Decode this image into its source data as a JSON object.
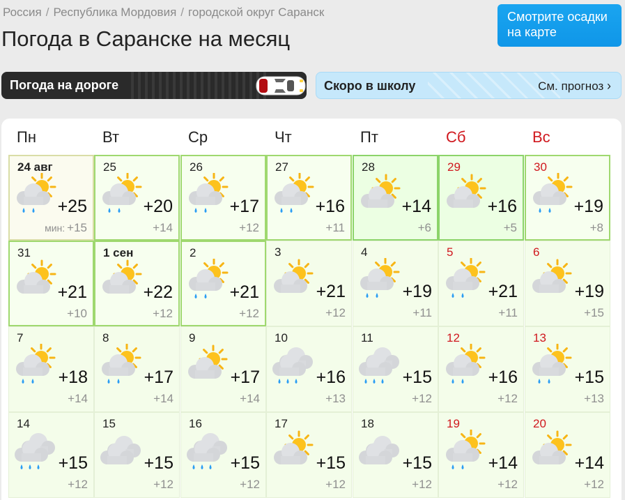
{
  "breadcrumbs": [
    "Россия",
    "Республика Мордовия",
    "городской округ Саранск"
  ],
  "breadcrumb_sep": "/",
  "title": "Погода в Саранске на месяц",
  "map_button": "Смотрите осадки на карте",
  "road_banner": "Погода на дороге",
  "school_banner": {
    "label": "Скоро в школу",
    "link": "См. прогноз"
  },
  "colors": {
    "weekend": "#d0181e",
    "accent": "#1aa5f0",
    "highlight_border": "#9fd86f"
  },
  "weekdays": [
    {
      "label": "Пн",
      "weekend": false
    },
    {
      "label": "Вт",
      "weekend": false
    },
    {
      "label": "Ср",
      "weekend": false
    },
    {
      "label": "Чт",
      "weekend": false
    },
    {
      "label": "Пт",
      "weekend": false
    },
    {
      "label": "Сб",
      "weekend": true
    },
    {
      "label": "Вс",
      "weekend": true
    }
  ],
  "min_label": "мин:",
  "days": [
    {
      "day": "24 авг",
      "bold": true,
      "weekend": false,
      "max": "+25",
      "min": "+15",
      "icon": "sun-cloud-rain-icon",
      "state": "past",
      "show_min_label": true
    },
    {
      "day": "25",
      "bold": false,
      "weekend": false,
      "max": "+20",
      "min": "+14",
      "icon": "sun-cloud-rain-icon",
      "state": "hl"
    },
    {
      "day": "26",
      "bold": false,
      "weekend": false,
      "max": "+17",
      "min": "+12",
      "icon": "sun-cloud-rain-icon",
      "state": "hl"
    },
    {
      "day": "27",
      "bold": false,
      "weekend": false,
      "max": "+16",
      "min": "+11",
      "icon": "sun-cloud-rain-icon",
      "state": "hl"
    },
    {
      "day": "28",
      "bold": false,
      "weekend": false,
      "max": "+14",
      "min": "+6",
      "icon": "sun-cloud-icon",
      "state": "hlg"
    },
    {
      "day": "29",
      "bold": false,
      "weekend": true,
      "max": "+16",
      "min": "+5",
      "icon": "sun-cloud-icon",
      "state": "hlg"
    },
    {
      "day": "30",
      "bold": false,
      "weekend": true,
      "max": "+19",
      "min": "+8",
      "icon": "sun-cloud-rain-icon",
      "state": "hl"
    },
    {
      "day": "31",
      "bold": false,
      "weekend": false,
      "max": "+21",
      "min": "+10",
      "icon": "sun-cloud-icon",
      "state": "hl"
    },
    {
      "day": "1 сен",
      "bold": true,
      "weekend": false,
      "max": "+22",
      "min": "+12",
      "icon": "sun-cloud-icon",
      "state": "hl"
    },
    {
      "day": "2",
      "bold": false,
      "weekend": false,
      "max": "+21",
      "min": "+12",
      "icon": "sun-cloud-rain-icon",
      "state": "hl"
    },
    {
      "day": "3",
      "bold": false,
      "weekend": false,
      "max": "+21",
      "min": "+12",
      "icon": "sun-cloud-icon",
      "state": "lt"
    },
    {
      "day": "4",
      "bold": false,
      "weekend": false,
      "max": "+19",
      "min": "+11",
      "icon": "sun-cloud-rain-icon",
      "state": "lt"
    },
    {
      "day": "5",
      "bold": false,
      "weekend": true,
      "max": "+21",
      "min": "+11",
      "icon": "sun-cloud-rain-icon",
      "state": "lt"
    },
    {
      "day": "6",
      "bold": false,
      "weekend": true,
      "max": "+19",
      "min": "+15",
      "icon": "sun-cloud-icon",
      "state": "lt"
    },
    {
      "day": "7",
      "bold": false,
      "weekend": false,
      "max": "+18",
      "min": "+14",
      "icon": "sun-cloud-rain-icon",
      "state": "lt"
    },
    {
      "day": "8",
      "bold": false,
      "weekend": false,
      "max": "+17",
      "min": "+14",
      "icon": "sun-cloud-rain-icon",
      "state": "lt"
    },
    {
      "day": "9",
      "bold": false,
      "weekend": false,
      "max": "+17",
      "min": "+14",
      "icon": "sun-cloud-icon",
      "state": "lt"
    },
    {
      "day": "10",
      "bold": false,
      "weekend": false,
      "max": "+16",
      "min": "+13",
      "icon": "cloud-rain-icon",
      "state": "lt"
    },
    {
      "day": "11",
      "bold": false,
      "weekend": false,
      "max": "+15",
      "min": "+12",
      "icon": "cloud-rain-icon",
      "state": "lt"
    },
    {
      "day": "12",
      "bold": false,
      "weekend": true,
      "max": "+16",
      "min": "+12",
      "icon": "sun-cloud-rain-icon",
      "state": "lt"
    },
    {
      "day": "13",
      "bold": false,
      "weekend": true,
      "max": "+15",
      "min": "+13",
      "icon": "sun-cloud-rain-icon",
      "state": "lt"
    },
    {
      "day": "14",
      "bold": false,
      "weekend": false,
      "max": "+15",
      "min": "+12",
      "icon": "cloud-rain-icon",
      "state": "lt"
    },
    {
      "day": "15",
      "bold": false,
      "weekend": false,
      "max": "+15",
      "min": "+12",
      "icon": "cloud-icon",
      "state": "lt"
    },
    {
      "day": "16",
      "bold": false,
      "weekend": false,
      "max": "+15",
      "min": "+12",
      "icon": "cloud-rain-icon",
      "state": "lt"
    },
    {
      "day": "17",
      "bold": false,
      "weekend": false,
      "max": "+15",
      "min": "+12",
      "icon": "sun-cloud-icon",
      "state": "lt"
    },
    {
      "day": "18",
      "bold": false,
      "weekend": false,
      "max": "+15",
      "min": "+12",
      "icon": "cloud-icon",
      "state": "lt"
    },
    {
      "day": "19",
      "bold": false,
      "weekend": true,
      "max": "+14",
      "min": "+12",
      "icon": "sun-cloud-rain-icon",
      "state": "lt"
    },
    {
      "day": "20",
      "bold": false,
      "weekend": true,
      "max": "+14",
      "min": "+12",
      "icon": "sun-cloud-icon",
      "state": "lt"
    }
  ]
}
